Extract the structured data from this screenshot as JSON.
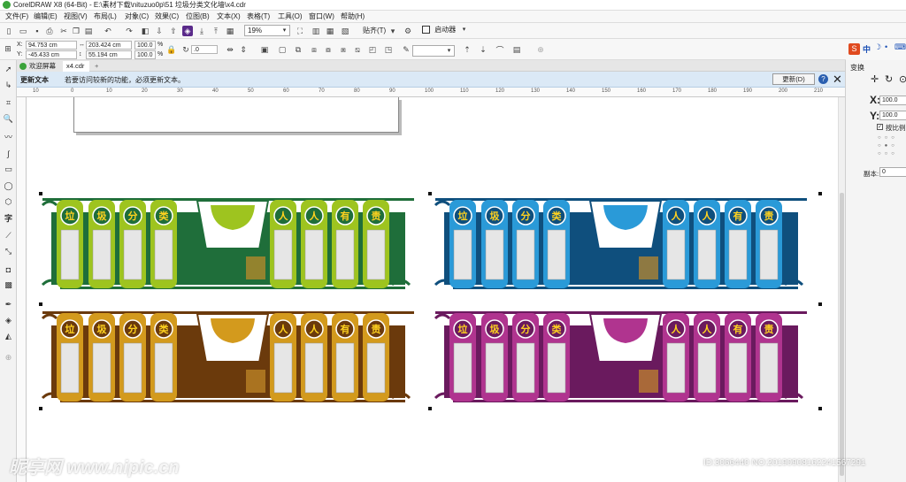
{
  "window": {
    "title": "CorelDRAW X8 (64-Bit) - E:\\素材下载\\nituzuo0p\\51 垃圾分类文化墙\\x4.cdr"
  },
  "menu": [
    "文件(F)",
    "编辑(E)",
    "视图(V)",
    "布局(L)",
    "对象(C)",
    "效果(C)",
    "位图(B)",
    "文本(X)",
    "表格(T)",
    "工具(O)",
    "窗口(W)",
    "帮助(H)"
  ],
  "toolbar": {
    "zoom": "19%",
    "snap_label": "贴齐(T)",
    "launcher_label": "启动器"
  },
  "props": {
    "x": "94.753 cm",
    "y": "-45.433 cm",
    "width": "203.424 cm",
    "height": "55.194 cm",
    "scale_x": "100.0",
    "scale_y": "100.0",
    "percent": "%",
    "angle": ".0"
  },
  "tabs": [
    "欢迎屏幕",
    "x4.cdr"
  ],
  "update_bar": {
    "title": "更新文本",
    "message": "若要访问较新的功能，必须更新文本。",
    "button": "更新(D)"
  },
  "ruler_labels": [
    "10",
    "0",
    "10",
    "20",
    "30",
    "40",
    "50",
    "60",
    "70",
    "80",
    "90",
    "100",
    "110",
    "120",
    "130",
    "140",
    "150",
    "160",
    "170",
    "180",
    "190",
    "200",
    "210",
    "220",
    "230"
  ],
  "docker": {
    "title": "变换",
    "x_value": "100.0",
    "y_value": "100.0",
    "proportional": "按比例",
    "copies_label": "副本:",
    "copies_value": "0",
    "lang_zh": "中"
  },
  "panel_colors": {
    "green_dark": "#1f6e3a",
    "green_light": "#9ec41f",
    "blue_dark": "#0f4f7d",
    "blue_light": "#2a9ad8",
    "orange_dark": "#6b3a0c",
    "orange_light": "#d39a1d",
    "purple_dark": "#6a1a5e",
    "purple_light": "#b0348f"
  },
  "panel_title_chars": [
    "垃",
    "圾",
    "分",
    "类",
    "人",
    "人",
    "有",
    "责"
  ],
  "watermark": "昵享网 www.nipic.cn",
  "id_tag": "ID:3066440 NO:20190908162241567291"
}
